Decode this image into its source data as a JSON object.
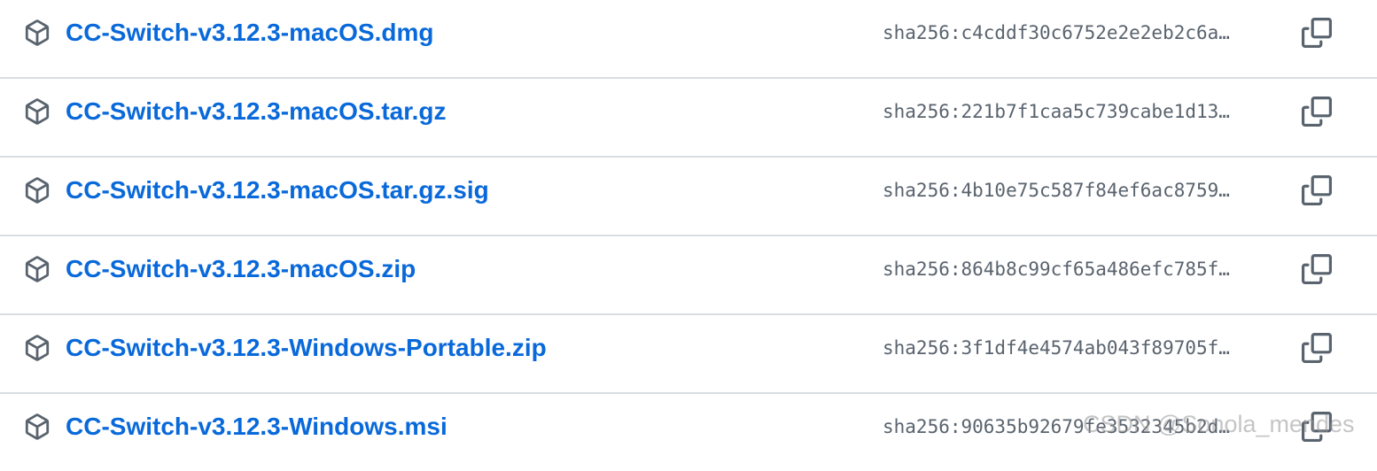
{
  "assets": [
    {
      "name": "CC-Switch-v3.12.3-macOS.dmg",
      "digest": "sha256:c4cddf30c6752e2e2eb2c6a…",
      "icon": "package-icon",
      "copy_icon": "copy-icon"
    },
    {
      "name": "CC-Switch-v3.12.3-macOS.tar.gz",
      "digest": "sha256:221b7f1caa5c739cabe1d13…",
      "icon": "package-icon",
      "copy_icon": "copy-icon"
    },
    {
      "name": "CC-Switch-v3.12.3-macOS.tar.gz.sig",
      "digest": "sha256:4b10e75c587f84ef6ac8759…",
      "icon": "package-icon",
      "copy_icon": "copy-icon"
    },
    {
      "name": "CC-Switch-v3.12.3-macOS.zip",
      "digest": "sha256:864b8c99cf65a486efc785f…",
      "icon": "package-icon",
      "copy_icon": "copy-icon"
    },
    {
      "name": "CC-Switch-v3.12.3-Windows-Portable.zip",
      "digest": "sha256:3f1df4e4574ab043f89705f…",
      "icon": "package-icon",
      "copy_icon": "copy-icon"
    },
    {
      "name": "CC-Switch-v3.12.3-Windows.msi",
      "digest": "sha256:90635b92679fe3532345b2d…",
      "icon": "package-icon",
      "copy_icon": "copy-icon"
    }
  ],
  "watermark": "CSDN @Sonola_mendes",
  "colors": {
    "link": "#0969da",
    "muted_text": "#59636e",
    "icon": "#59636e",
    "divider": "#d8dee4",
    "background": "#ffffff"
  }
}
